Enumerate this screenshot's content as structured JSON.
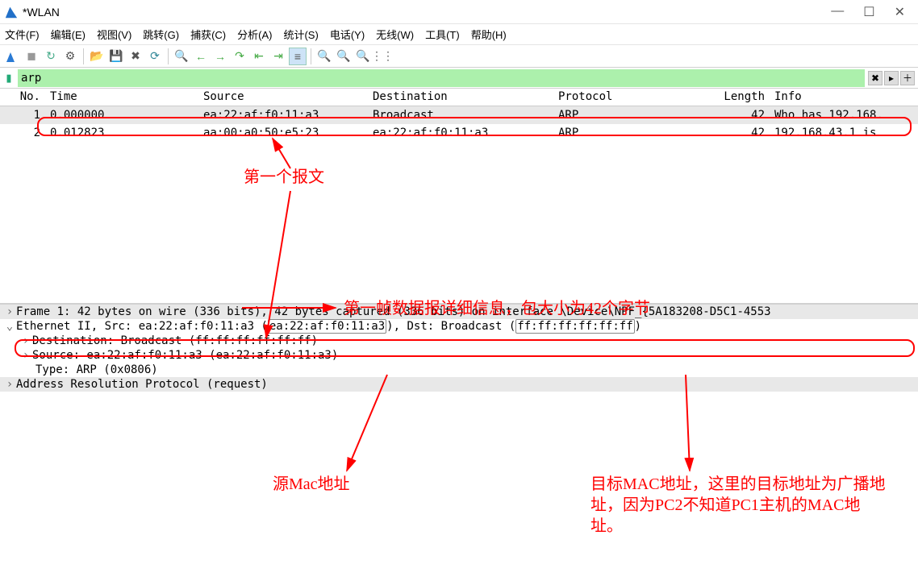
{
  "window": {
    "title": "*WLAN"
  },
  "menu": {
    "items": [
      "文件(F)",
      "编辑(E)",
      "视图(V)",
      "跳转(G)",
      "捕获(C)",
      "分析(A)",
      "统计(S)",
      "电话(Y)",
      "无线(W)",
      "工具(T)",
      "帮助(H)"
    ]
  },
  "filter": {
    "value": "arp"
  },
  "columns": {
    "no": "No.",
    "time": "Time",
    "src": "Source",
    "dst": "Destination",
    "proto": "Protocol",
    "len": "Length",
    "info": "Info"
  },
  "packets": [
    {
      "no": "1",
      "time": "0.000000",
      "src": "ea:22:af:f0:11:a3",
      "dst": "Broadcast",
      "proto": "ARP",
      "len": "42",
      "info": "Who has 192.168."
    },
    {
      "no": "2",
      "time": "0.012823",
      "src": "aa:00:a0:50:e5:23",
      "dst": "ea:22:af:f0:11:a3",
      "proto": "ARP",
      "len": "42",
      "info": "192.168.43.1 is"
    }
  ],
  "details": {
    "frame": "Frame 1: 42 bytes on wire (336 bits), 42 bytes captured (336 bits) on interface \\Device\\NPF_{5A183208-D5C1-4553",
    "eth_prefix": "Ethernet II, Src: ea:22:af:f0:11:a3 (",
    "eth_srcmac": "ea:22:af:f0:11:a3",
    "eth_mid": "), Dst: Broadcast (",
    "eth_dstmac": "ff:ff:ff:ff:ff:ff",
    "eth_suffix": ")",
    "dst": "Destination: Broadcast (ff:ff:ff:ff:ff:ff)",
    "src": "Source: ea:22:af:f0:11:a3 (ea:22:af:f0:11:a3)",
    "type": "Type: ARP (0x0806)",
    "arp": "Address Resolution Protocol (request)"
  },
  "annotations": {
    "first_packet": "第一个报文",
    "frame_detail": "第一帧数据报详细信息，包大小为42个字节",
    "src_mac": "源Mac地址",
    "dst_mac": "目标MAC地址，这里的目标地址为广播地址，因为PC2不知道PC1主机的MAC地址。"
  }
}
